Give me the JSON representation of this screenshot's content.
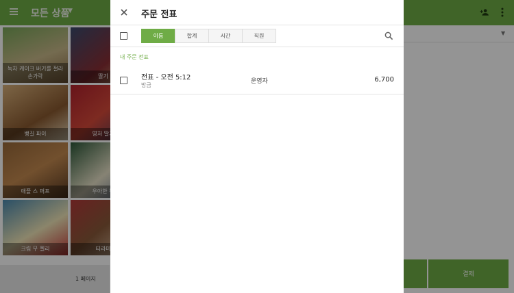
{
  "app": {
    "title": "모든 상품",
    "icons": [
      "menu-icon",
      "chevron-down-icon",
      "person-add-icon",
      "more-vert-icon"
    ],
    "products": [
      {
        "label": "녹차 케이크 버기를 절라 손가락"
      },
      {
        "label": "딸기"
      },
      {
        "label": "뱅길 파이"
      },
      {
        "label": "영처 딸기"
      },
      {
        "label": "애플 스 퍼프"
      },
      {
        "label": "우아한 무"
      },
      {
        "label": "크림 무 젤리"
      },
      {
        "label": "티라미"
      }
    ],
    "page_label": "1 페이지",
    "pay_label": "결제"
  },
  "drawer": {
    "title": "주문 전표",
    "sort_tabs": [
      {
        "label": "이름"
      },
      {
        "label": "합계"
      },
      {
        "label": "시간"
      },
      {
        "label": "직원"
      }
    ],
    "active_tab": "이름",
    "section_label": "내 주문 전표",
    "tickets": [
      {
        "name": "전표 - 오전 5:12",
        "sub": "방금",
        "employee": "운영자",
        "amount": "6,700"
      }
    ],
    "icons": [
      "close-icon",
      "checkbox-icon",
      "search-icon"
    ]
  },
  "colors": {
    "accent": "#6fac46",
    "scrim": "rgba(0,0,0,0.42)"
  }
}
